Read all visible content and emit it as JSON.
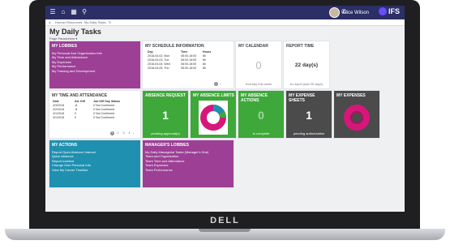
{
  "device": {
    "brand": "DELL"
  },
  "topbar": {
    "user": "Alice Wilson",
    "logo": "IFS"
  },
  "breadcrumb": [
    "Human Resources",
    "My Daily Tasks"
  ],
  "page": {
    "title": "My Daily Tasks",
    "params": "Page Parameters ▾"
  },
  "lobbies": {
    "title": "MY LOBBIES",
    "items": [
      "My Personal And Organization Info",
      "My Time and Attendance",
      "My Expenses",
      "My Performance",
      "My Training and Development"
    ]
  },
  "schedule": {
    "title": "MY SCHEDULE INFORMATION",
    "headers": [
      "Day",
      "Time",
      "Hours"
    ],
    "rows": [
      [
        "2018-04-02, Mon",
        "08:00-16:00",
        "8h"
      ],
      [
        "2018-04-03, Tue",
        "08:00-16:00",
        "8h"
      ],
      [
        "2018-04-04, Wed",
        "08:00-16:00",
        "8h"
      ],
      [
        "2018-04-05, Thu",
        "08:00-16:00",
        "8h"
      ]
    ],
    "page": "1"
  },
  "calendar": {
    "title": "MY CALENDAR",
    "value": "0",
    "caption": "event(s) this week"
  },
  "report_time": {
    "title": "REPORT TIME",
    "value": "22 day(s)",
    "caption": "to report (last 30 days)"
  },
  "time_attendance": {
    "title": "MY TIME AND ATTENDANCE",
    "headers": [
      "Date",
      "Att. Diff",
      "Job Diff Day Status"
    ],
    "rows": [
      [
        "4/3/2018",
        "-8",
        "0 Not Confirmed"
      ],
      [
        "4/2/2018",
        "-8",
        "0 Not Confirmed"
      ],
      [
        "4/1/2018",
        "0",
        "0 Not Confirmed"
      ],
      [
        "4/1/2018",
        "0",
        "0 Not Confirmed"
      ]
    ],
    "pages": [
      "1",
      "2",
      "3",
      "4"
    ]
  },
  "absence_request": {
    "title": "ABSENCE REQUEST",
    "value": "1",
    "caption": "pending approval(s)"
  },
  "absence_limits": {
    "title": "MY ABSENCE LIMITS"
  },
  "absence_actions": {
    "title": "MY ABSENCE ACTIONS",
    "value": "0",
    "caption": "to complete"
  },
  "expense_sheets": {
    "title": "MY EXPENSE SHEETS",
    "value": "1",
    "caption": "pending authorization"
  },
  "expenses": {
    "title": "MY EXPENSES"
  },
  "actions": {
    "title": "MY ACTIONS",
    "items": [
      "Report Open Absence Interval",
      "Quick Absence",
      "Report Incident",
      "Change Own Personal Info",
      "View My Career Timeline"
    ]
  },
  "manager_lobbies": {
    "title": "MANAGER'S LOBBIES",
    "items": [
      "My Daily Managerial Tasks (Manager's Hub)",
      "Team and Organization",
      "Team Time and Attendance",
      "Team Expenses",
      "Team Performance"
    ]
  },
  "colors": {
    "purple": "#9c3f95",
    "green": "#3ea83a",
    "teal": "#1f90b0",
    "dark": "#4b4b4b",
    "magenta": "#d6177a",
    "navy": "#2b2f66"
  }
}
